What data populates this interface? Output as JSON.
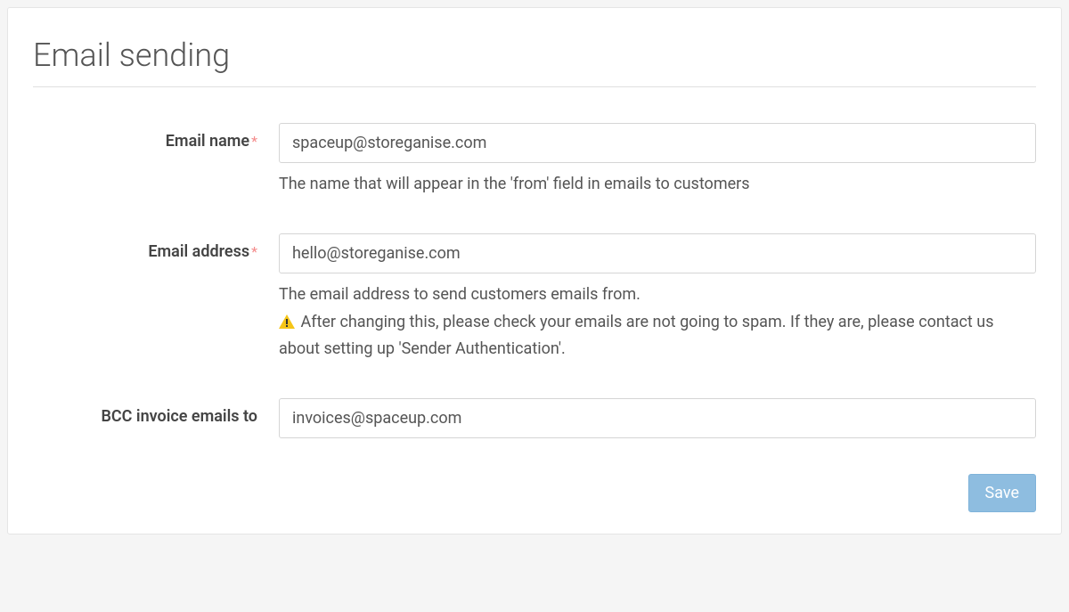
{
  "section": {
    "title": "Email sending"
  },
  "fields": {
    "emailName": {
      "label": "Email name",
      "required": "*",
      "value": "spaceup@storeganise.com",
      "help": "The name that will appear in the 'from' field in emails to customers"
    },
    "emailAddress": {
      "label": "Email address",
      "required": "*",
      "value": "hello@storeganise.com",
      "help1": "The email address to send customers emails from.",
      "help2": " After changing this, please check your emails are not going to spam. If they are, please contact us about setting up 'Sender Authentication'."
    },
    "bcc": {
      "label": "BCC invoice emails to",
      "value": "invoices@spaceup.com"
    }
  },
  "buttons": {
    "save": "Save"
  }
}
